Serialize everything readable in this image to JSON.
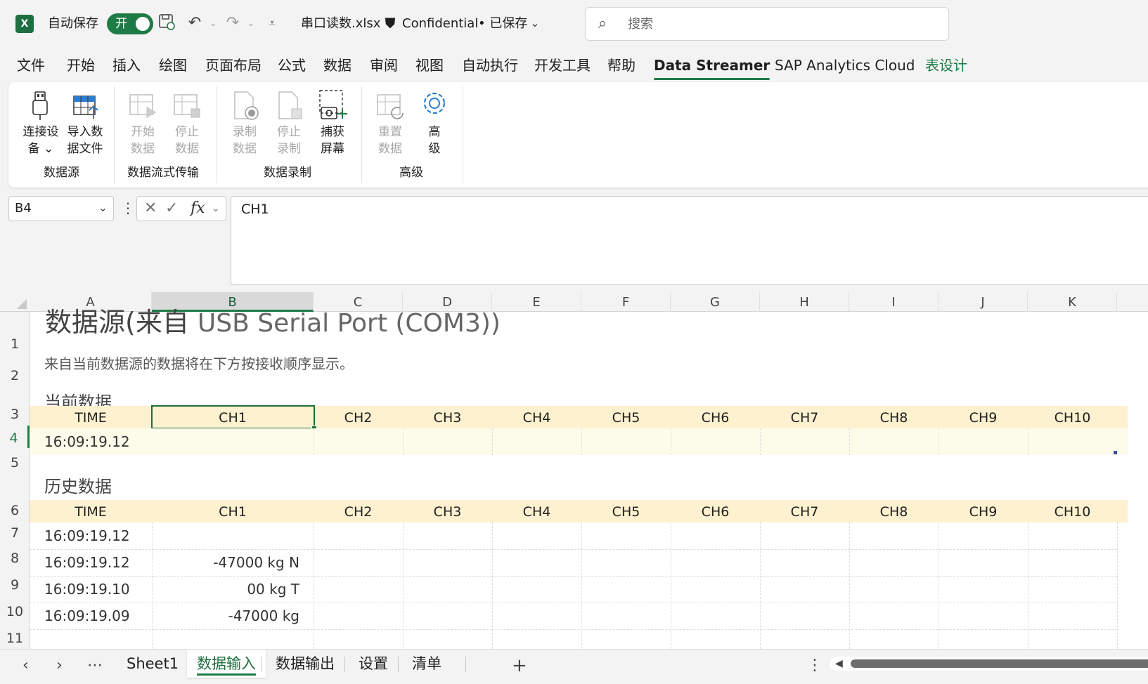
{
  "titlebar": {
    "app_icon": "X",
    "autosave_label": "自动保存",
    "autosave_state": "开",
    "filename": "串口读数.xlsx",
    "sensitivity": "Confidential",
    "save_status": "• 已保存",
    "search_placeholder": "搜索"
  },
  "menu": {
    "items": [
      "文件",
      "开始",
      "插入",
      "绘图",
      "页面布局",
      "公式",
      "数据",
      "审阅",
      "视图",
      "自动执行",
      "开发工具",
      "帮助",
      "Data Streamer",
      "SAP Analytics Cloud",
      "表设计"
    ],
    "active": "Data Streamer",
    "accent": "#1e7b45"
  },
  "ribbon": {
    "buttons": [
      {
        "label1": "连接设",
        "label2": "备 ⌄",
        "icon": "usb-plug-icon",
        "enabled": true
      },
      {
        "label1": "导入数",
        "label2": "据文件",
        "icon": "import-table-icon",
        "enabled": true
      },
      {
        "label1": "开始",
        "label2": "数据",
        "icon": "start-data-icon",
        "enabled": false
      },
      {
        "label1": "停止",
        "label2": "数据",
        "icon": "stop-data-icon",
        "enabled": false
      },
      {
        "label1": "录制",
        "label2": "数据",
        "icon": "record-data-icon",
        "enabled": false
      },
      {
        "label1": "停止",
        "label2": "录制",
        "icon": "stop-record-icon",
        "enabled": false
      },
      {
        "label1": "捕获",
        "label2": "屏幕",
        "icon": "capture-screen-icon",
        "enabled": true
      },
      {
        "label1": "重置",
        "label2": "数据",
        "icon": "reset-data-icon",
        "enabled": false
      },
      {
        "label1": "高",
        "label2": "级",
        "icon": "gear-icon",
        "enabled": true
      }
    ],
    "groups": [
      "数据源",
      "数据流式传输",
      "数据录制",
      "高级"
    ]
  },
  "formula_bar": {
    "name_box": "B4",
    "formula": "CH1"
  },
  "grid": {
    "columns": [
      "A",
      "B",
      "C",
      "D",
      "E",
      "F",
      "G",
      "H",
      "I",
      "J",
      "K"
    ],
    "selected_column": "B",
    "rows": [
      "1",
      "2",
      "3",
      "4",
      "5",
      "6",
      "7",
      "8",
      "9",
      "10",
      "11"
    ],
    "selected_row": "4",
    "title_bold": "数据源(来自",
    "title_light": "USB Serial Port (COM3))",
    "subtitle": "来自当前数据源的数据将在下方按接收顺序显示。",
    "current_section": "当前数据",
    "history_section": "历史数据",
    "headers": [
      "TIME",
      "CH1",
      "CH2",
      "CH3",
      "CH4",
      "CH5",
      "CH6",
      "CH7",
      "CH8",
      "CH9",
      "CH10"
    ],
    "current_time": "16:09:19.12",
    "history": [
      {
        "time": "16:09:19.12",
        "ch1": ""
      },
      {
        "time": "16:09:19.12",
        "ch1": "-47000 kg N"
      },
      {
        "time": "16:09:19.10",
        "ch1": "00 kg T"
      },
      {
        "time": "16:09:19.09",
        "ch1": "-47000 kg"
      }
    ],
    "header_band_color": "#fdf1cf"
  },
  "sheets": {
    "tabs": [
      "Sheet1",
      "数据输入",
      "数据输出",
      "设置",
      "清单"
    ],
    "active": "数据输入",
    "add_label": "+"
  }
}
